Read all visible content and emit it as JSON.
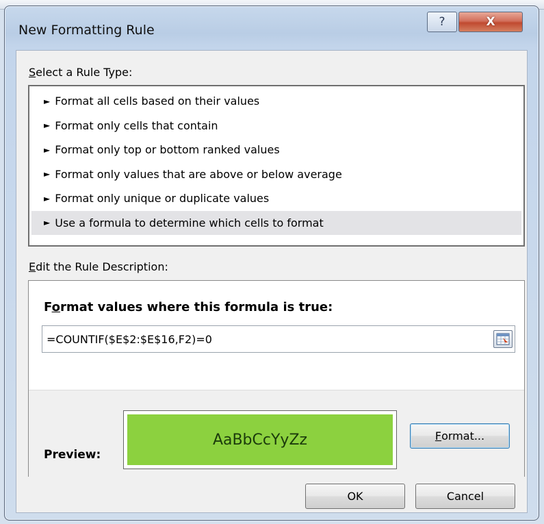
{
  "dialog": {
    "title": "New Formatting Rule",
    "help_glyph": "?",
    "close_glyph": "X"
  },
  "rule_type": {
    "label": "Select a Rule Type:",
    "label_mnemonic": "S",
    "label_rest": "elect a Rule Type:",
    "items": [
      {
        "label": "Format all cells based on their values",
        "selected": false
      },
      {
        "label": "Format only cells that contain",
        "selected": false
      },
      {
        "label": "Format only top or bottom ranked values",
        "selected": false
      },
      {
        "label": "Format only values that are above or below average",
        "selected": false
      },
      {
        "label": "Format only unique or duplicate values",
        "selected": false
      },
      {
        "label": "Use a formula to determine which cells to format",
        "selected": true
      }
    ],
    "arrow_glyph": "►"
  },
  "description": {
    "label": "Edit the Rule Description:",
    "label_mnemonic": "E",
    "label_rest": "dit the Rule Description:",
    "formula_heading_pre": "F",
    "formula_heading_mnemonic": "o",
    "formula_heading_rest": "rmat values where this formula is true:",
    "formula_value": "=COUNTIF($E$2:$E$16,F2)=0",
    "preview_label": "Preview:",
    "preview_text": "AaBbCcYyZz",
    "preview_fill_color": "#8cd13f",
    "format_button_mnemonic": "F",
    "format_button_rest": "ormat..."
  },
  "buttons": {
    "ok": "OK",
    "cancel": "Cancel"
  },
  "colors": {
    "close_button": "#c04a30",
    "selected_row": "#e3e3e6",
    "focus_border": "#3c7fb1"
  }
}
